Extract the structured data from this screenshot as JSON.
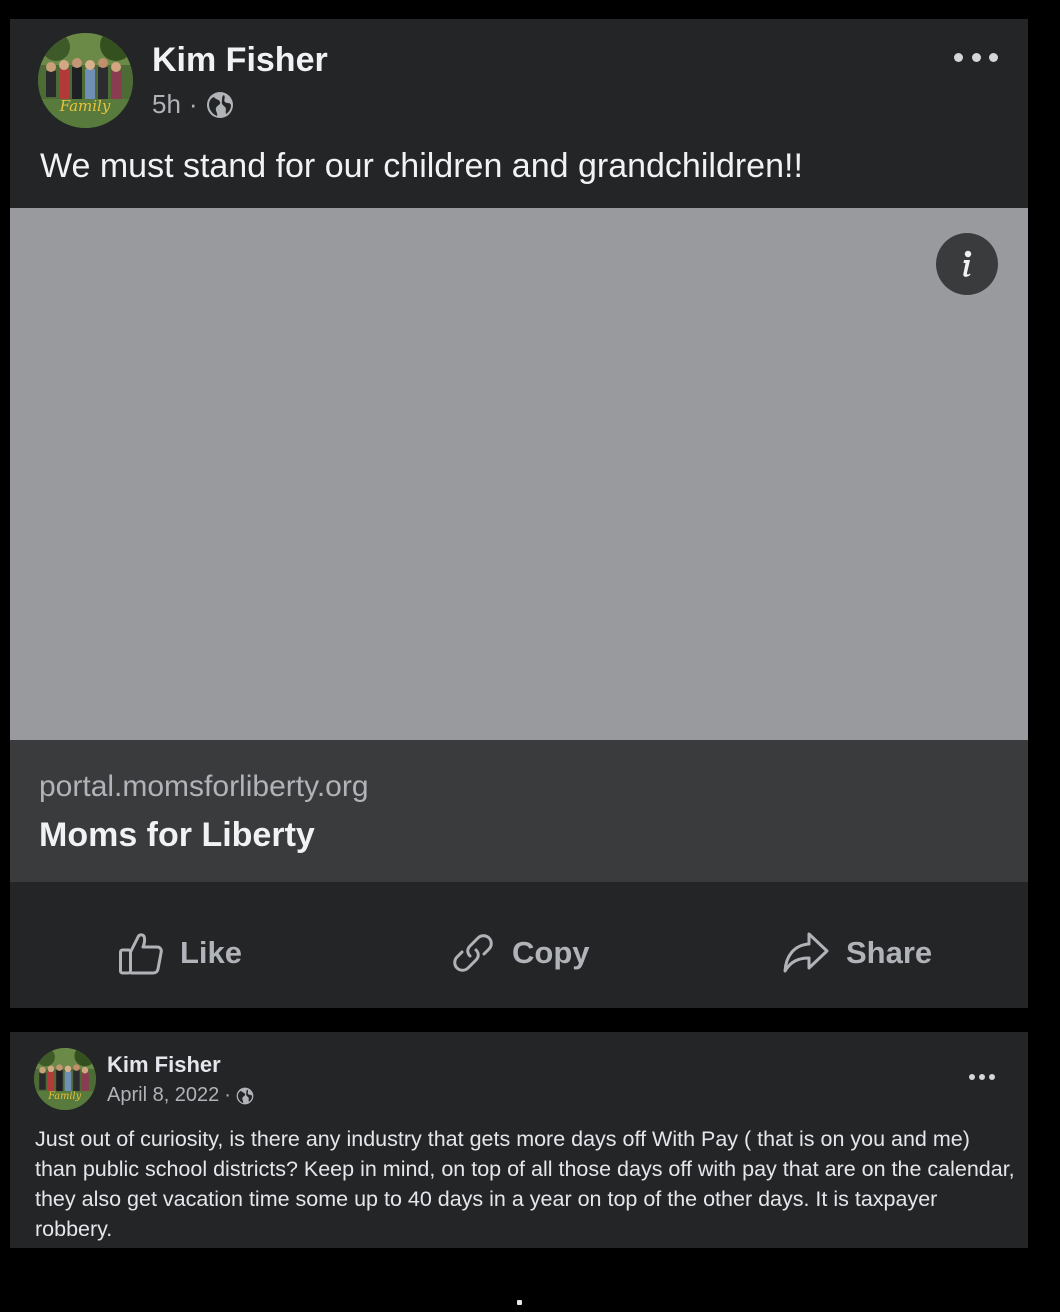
{
  "post": {
    "author": "Kim Fisher",
    "time": "5h",
    "separator": "·",
    "audience_icon": "globe-icon",
    "more_icon": "more-horizontal-icon",
    "text": "We must stand for our children and grandchildren!!",
    "avatar_caption": "Family",
    "link": {
      "domain": "portal.momsforliberty.org",
      "title": "Moms for Liberty",
      "info_icon": "info-icon"
    },
    "actions": [
      {
        "label": "Like",
        "icon": "thumbs-up-icon"
      },
      {
        "label": "Copy",
        "icon": "link-icon"
      },
      {
        "label": "Share",
        "icon": "share-arrow-icon"
      }
    ]
  },
  "screenshot_post": {
    "author": "Kim Fisher",
    "date": "April 8, 2022",
    "separator": "·",
    "audience_icon": "globe-icon",
    "more_icon": "more-horizontal-icon",
    "text": "Just out of curiosity, is there any industry that gets more days off With Pay ( that is on you and me) than public school districts?  Keep in mind, on top of all those days off with pay that are on the calendar, they also get vacation time some up to 40 days in a year on top of the other days.  It is taxpayer robbery."
  },
  "colors": {
    "card_bg": "#242526",
    "link_image_bg": "#989a9e",
    "link_caption_bg": "#3a3b3c",
    "primary_text": "#e4e6eb",
    "secondary_text": "#b0b3b8"
  }
}
